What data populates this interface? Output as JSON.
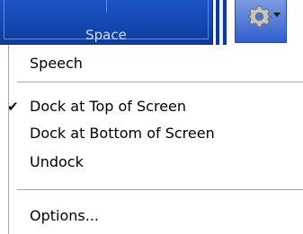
{
  "toolbar": {
    "space_key_label": "Space",
    "settings_icon": "gear-icon",
    "dropdown_icon": "chevron-down-icon"
  },
  "menu": {
    "items": [
      {
        "label": "Speech",
        "checked": false
      },
      {
        "label": "Dock at Top of Screen",
        "checked": true
      },
      {
        "label": "Dock at Bottom of Screen",
        "checked": false
      },
      {
        "label": "Undock",
        "checked": false
      },
      {
        "label": "Options...",
        "checked": false
      }
    ],
    "check_glyph": "✔"
  },
  "colors": {
    "key_blue": "#1346ae",
    "menu_border": "#aca899",
    "menu_bg": "#ffffff"
  }
}
